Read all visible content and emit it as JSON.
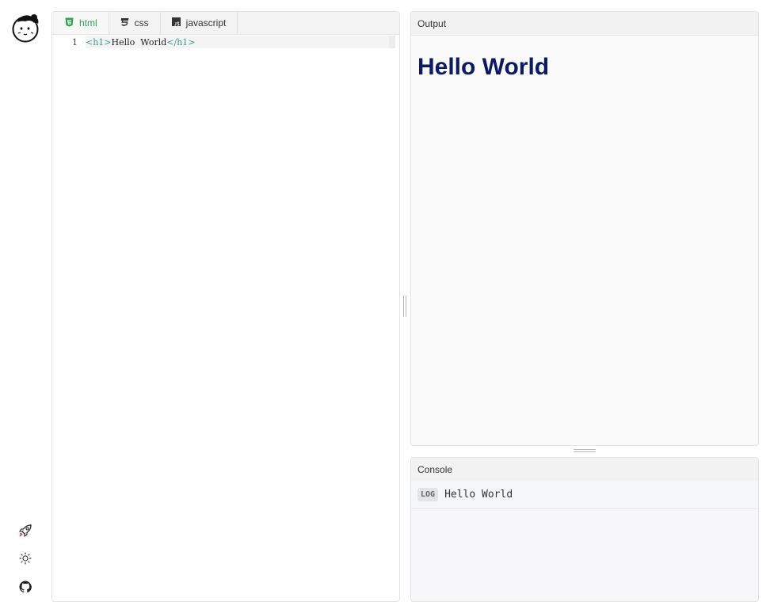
{
  "rail": {
    "logo_icon": "cartoon-face-logo",
    "items": [
      {
        "icon": "rocket-icon"
      },
      {
        "icon": "sun-icon"
      },
      {
        "icon": "github-icon"
      }
    ]
  },
  "editor": {
    "tabs": [
      {
        "label": "html",
        "icon": "html5-icon",
        "active": true,
        "color": "#2ea44f"
      },
      {
        "label": "css",
        "icon": "css3-icon",
        "active": false
      },
      {
        "label": "javascript",
        "icon": "js-icon",
        "active": false
      }
    ],
    "lines": [
      {
        "number": "1",
        "open_tag": "<h1>",
        "text": "Hello  World",
        "close_tag": "</h1>"
      }
    ]
  },
  "output": {
    "title": "Output",
    "heading": "Hello World",
    "heading_color": "#0a1a66"
  },
  "console": {
    "title": "Console",
    "entries": [
      {
        "level": "LOG",
        "message": "Hello World"
      }
    ]
  }
}
